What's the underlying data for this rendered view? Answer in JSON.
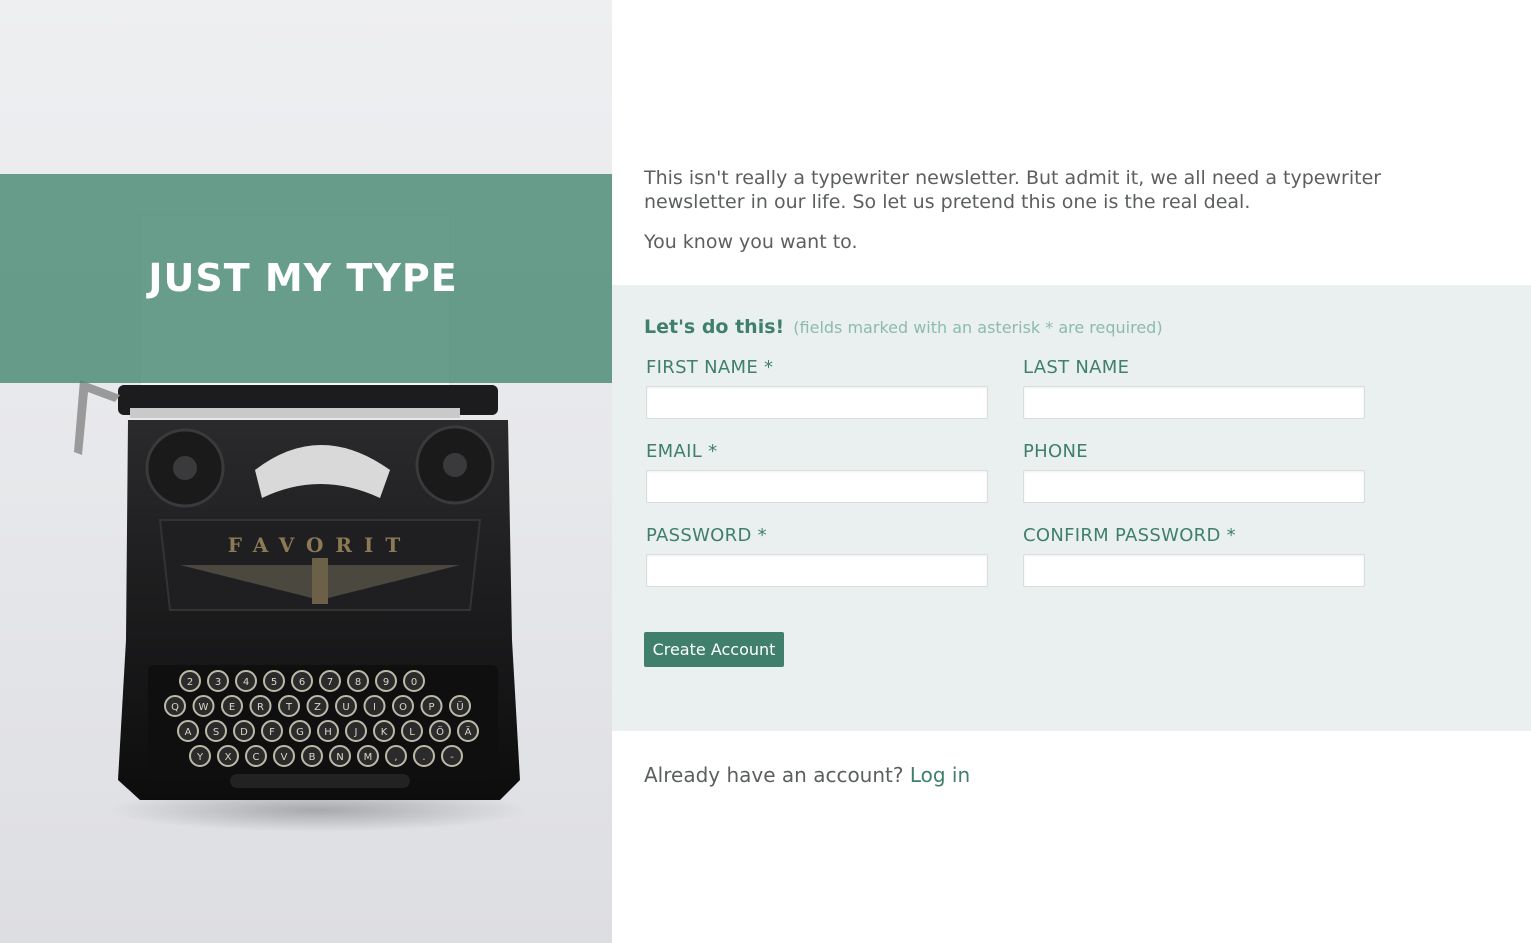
{
  "brand": {
    "title": "JUST MY TYPE"
  },
  "hero": {
    "keys_row1": [
      "2",
      "3",
      "4",
      "5",
      "6",
      "7",
      "8",
      "9",
      "0"
    ],
    "keys_row2": [
      "Q",
      "W",
      "E",
      "R",
      "T",
      "Z",
      "U",
      "I",
      "O",
      "P",
      "Ü"
    ],
    "keys_row3": [
      "A",
      "S",
      "D",
      "F",
      "G",
      "H",
      "J",
      "K",
      "L",
      "Ö",
      "Ä"
    ],
    "keys_row4": [
      "Y",
      "X",
      "C",
      "V",
      "B",
      "N",
      "M",
      ",",
      ".",
      "-"
    ]
  },
  "intro": {
    "paragraph1": "This isn't really a typewriter newsletter. But admit it, we all need a typewriter newsletter in our life. So let us pretend this one is the real deal.",
    "paragraph2": "You know you want to."
  },
  "form": {
    "heading": "Let's do this!",
    "note": "(fields marked with an asterisk * are required)",
    "fields": {
      "first_name": {
        "label": "FIRST NAME *",
        "value": ""
      },
      "last_name": {
        "label": "LAST NAME",
        "value": ""
      },
      "email": {
        "label": "EMAIL *",
        "value": ""
      },
      "phone": {
        "label": "PHONE",
        "value": ""
      },
      "password": {
        "label": "PASSWORD *",
        "value": ""
      },
      "confirm_password": {
        "label": "CONFIRM PASSWORD *",
        "value": ""
      }
    },
    "submit_label": "Create Account"
  },
  "login": {
    "prompt": "Already have an account?",
    "link_label": "Log in"
  },
  "colors": {
    "accent": "#3f7f6c",
    "band": "#5e9584",
    "form_bg": "#e9f0ef",
    "text": "#5b5f5d"
  }
}
